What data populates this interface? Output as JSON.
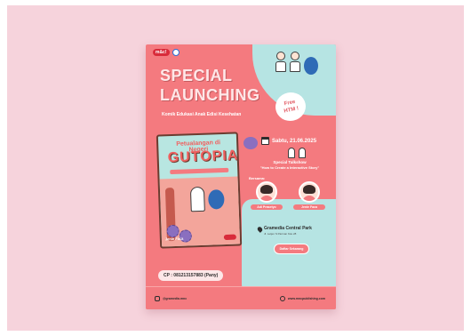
{
  "poster": {
    "brand_logo_text": "m&c!",
    "title_line1": "SPECIAL",
    "title_line2": "LAUNCHING",
    "subtitle": "Komik Edukasi Anak Edisi Kesehatan",
    "free_badge_line1": "Free",
    "free_badge_line2": "HTM !",
    "book": {
      "title_small": "Petualangan di Negeri",
      "title_big": "GUTOPIA",
      "author": "Jenie Faca"
    },
    "date": "Sabtu, 21.06.2025",
    "talkshow": {
      "label": "Special Talkshow",
      "topic": "\"How to Create a Interactive Story\"",
      "speakers_label": "Bersama:"
    },
    "speakers": [
      {
        "name": "Adi Prasetyo"
      },
      {
        "name": "Jenie Faca"
      }
    ],
    "venue": {
      "name": "Gramedia Central Park",
      "address": "Jl. Letjen S Parman Kav 28"
    },
    "register_label": "Daftar Sekarang",
    "contact": "CP : 081213157883 (Pany)",
    "footer": {
      "social": "@gramedia.mnc",
      "website": "www.mncpublishing.com"
    }
  },
  "colors": {
    "backdrop": "#f6d3dc",
    "poster_coral": "#f47a7f",
    "poster_teal": "#b6e4e3",
    "accent_red": "#d82b3a"
  }
}
